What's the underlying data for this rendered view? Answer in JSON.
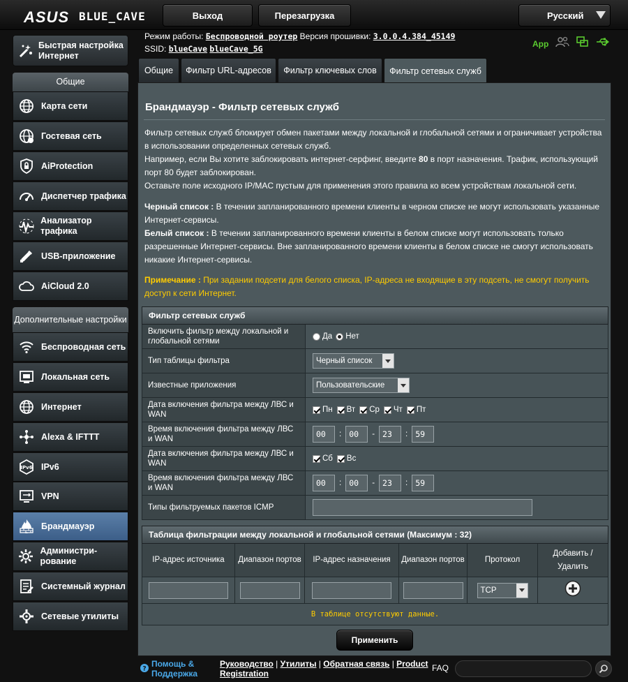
{
  "header": {
    "logo": "ASUS",
    "model": "BLUE_CAVE",
    "logout_label": "Выход",
    "reboot_label": "Перезагрузка",
    "language": "Русский"
  },
  "info": {
    "mode_label": "Режим работы:",
    "mode_value": "Беспроводной роутер",
    "firmware_label": "Версия прошивки:",
    "firmware_value": "3.0.0.4.384_45149",
    "ssid_label": "SSID:",
    "ssid_1": "blueCave",
    "ssid_2": "blueCave_5G",
    "app_label": "App"
  },
  "sidebar": {
    "quick_setup": "Быстрая настройка Интернет",
    "general_header": "Общие",
    "general_items": [
      {
        "label": "Карта сети",
        "icon": "globe-icon"
      },
      {
        "label": "Гостевая сеть",
        "icon": "globe-guest-icon"
      },
      {
        "label": "AiProtection",
        "icon": "lock-icon"
      },
      {
        "label": "Диспетчер трафика",
        "icon": "gauge-icon"
      },
      {
        "label": "Анализатор трафика",
        "icon": "wave-icon"
      },
      {
        "label": "USB-приложение",
        "icon": "usb-icon"
      },
      {
        "label": "AiCloud 2.0",
        "icon": "cloud-icon"
      }
    ],
    "advanced_header": "Дополнительные настройки",
    "advanced_items": [
      {
        "label": "Беспроводная сеть",
        "icon": "wifi-icon"
      },
      {
        "label": "Локальная сеть",
        "icon": "lan-icon"
      },
      {
        "label": "Интернет",
        "icon": "internet-icon"
      },
      {
        "label": "Alexa & IFTTT",
        "icon": "alexa-icon"
      },
      {
        "label": "IPv6",
        "icon": "ipv6-icon"
      },
      {
        "label": "VPN",
        "icon": "vpn-icon"
      },
      {
        "label": "Брандмауэр",
        "icon": "firewall-icon"
      },
      {
        "label": "Администри-рование",
        "icon": "admin-icon"
      },
      {
        "label": "Системный журнал",
        "icon": "log-icon"
      },
      {
        "label": "Сетевые утилиты",
        "icon": "tools-icon"
      }
    ],
    "active_item": "Брандмауэр"
  },
  "tabs": [
    {
      "label": "Общие"
    },
    {
      "label": "Фильтр URL-адресов"
    },
    {
      "label": "Фильтр ключевых слов"
    },
    {
      "label": "Фильтр сетевых служб"
    }
  ],
  "main": {
    "title": "Брандмауэр - Фильтр сетевых служб",
    "desc_1": "Фильтр сетевых служб блокирует обмен пакетами между локальной и глобальной сетями и ограничивает устройства в использовании определенных сетевых служб.",
    "desc_2a": "Например, если Вы хотите заблокировать интернет-серфинг, введите ",
    "desc_2b": "80",
    "desc_2c": " в порт назначения. Трафик, использующий порт 80 будет заблокирован.",
    "desc_3": "Оставьте поле исходного IP/MAC пустым для применения этого правила ко всем устройствам локальной сети.",
    "black_label": "Черный список :",
    "black_text": " В течении запланированного времени клиенты в черном списке не могут использовать указанные Интернет-сервисы.",
    "white_label": "Белый список :",
    "white_text": " В течении запланированного времени клиенты в белом списке могут использовать только разрешенные Интернет-сервисы. Вне запланированного времени клиенты в белом списке не смогут использовать никакие Интернет-сервисы.",
    "note_label": "Примечание :",
    "note_text": " При задании подсети для белого списка, IP-адреса не входящие в эту подсеть, не смогут получить доступ к сети Интернет."
  },
  "filter": {
    "header": "Фильтр сетевых служб",
    "enable_label": "Включить фильтр между локальной и глобальной сетями",
    "yes": "Да",
    "no": "Нет",
    "enable_value": "Нет",
    "table_type_label": "Тип таблицы фильтра",
    "table_type_value": "Черный список",
    "apps_label": "Известные приложения",
    "apps_value": "Пользовательские",
    "date1_label": "Дата включения фильтра между ЛВС и WAN",
    "days1": [
      "Пн",
      "Вт",
      "Ср",
      "Чт",
      "Пт"
    ],
    "time1_label": "Время включения фильтра между ЛВС и WAN",
    "time1": [
      "00",
      "00",
      "23",
      "59"
    ],
    "date2_label": "Дата включения фильтра между ЛВС и WAN",
    "days2": [
      "Сб",
      "Вс"
    ],
    "time2_label": "Время включения фильтра между ЛВС и WAN",
    "time2": [
      "00",
      "00",
      "23",
      "59"
    ],
    "icmp_label": "Типы фильтруемых пакетов ICMP",
    "icmp_value": ""
  },
  "rules_table": {
    "header": "Таблица фильтрации между локальной и глобальной сетями (Максимум : 32)",
    "columns": [
      "IP-адрес источника",
      "Диапазон портов",
      "IP-адрес назначения",
      "Диапазон портов",
      "Протокол",
      "Добавить / Удалить"
    ],
    "protocol_value": "TCP",
    "empty_text": "В таблице отсутствуют данные."
  },
  "apply_label": "Применить",
  "footer": {
    "help": "Помощь & Поддержка",
    "manual": "Руководство",
    "utilities": "Утилиты",
    "feedback": "Обратная связь",
    "product_registration": "Product Registration",
    "faq": "FAQ",
    "search_value": ""
  }
}
